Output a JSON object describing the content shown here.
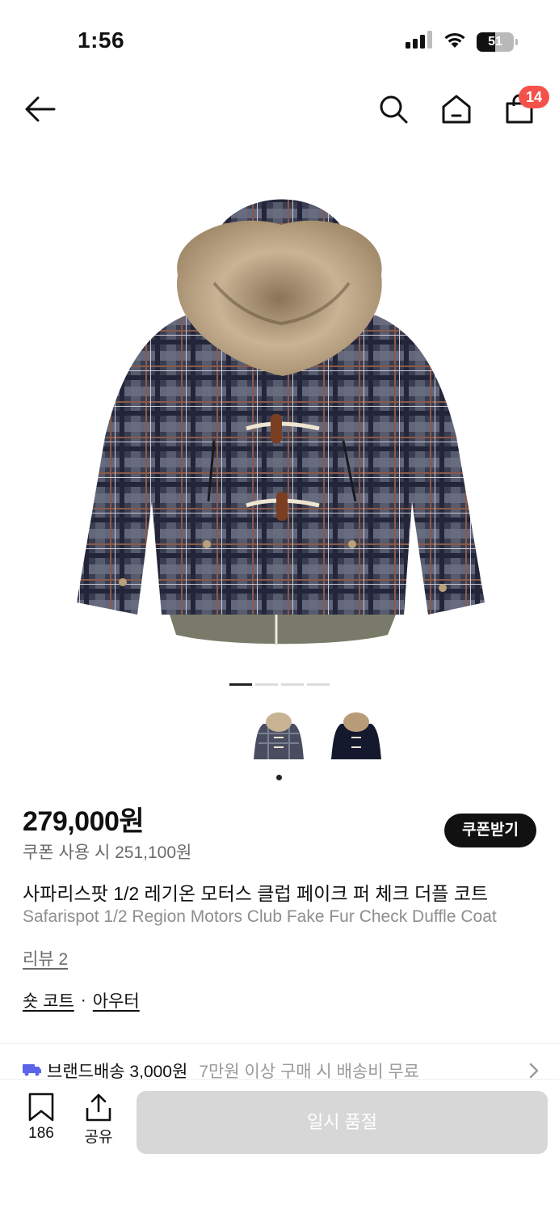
{
  "status_bar": {
    "time": "1:56",
    "battery": "51",
    "battery_level": 0.51
  },
  "nav": {
    "back_icon": "arrow-left-icon",
    "search_icon": "search-icon",
    "home_icon": "home-icon",
    "cart_icon": "shopping-bag-icon",
    "cart_count": "14"
  },
  "gallery": {
    "image_count": 4,
    "active_index": 0,
    "thumbnail_count": 2,
    "active_thumbnail": 0
  },
  "product": {
    "price": "279,000원",
    "coupon_price": "쿠폰 사용 시 251,100원",
    "coupon_button": "쿠폰받기",
    "title_ko": "사파리스팟 1/2 레기온 모터스 클럽 페이크 퍼 체크 더플 코트",
    "title_en": "Safarispot 1/2 Region Motors Club Fake Fur Check Duffle Coat",
    "review": "리뷰 2",
    "categories": {
      "first": "숏 코트",
      "separator": "·",
      "second": "아우터"
    }
  },
  "shipping": {
    "icon": "truck-icon",
    "label": "브랜드배송 3,000원",
    "sub": "7만원 이상 구매 시 배송비 무료"
  },
  "bottom_bar": {
    "bookmark_count": "186",
    "share_label": "공유",
    "soldout_label": "일시 품절"
  },
  "colors": {
    "accent_badge": "#f2524a",
    "coupon_button": "#111111",
    "soldout_button": "#d7d7d7"
  }
}
